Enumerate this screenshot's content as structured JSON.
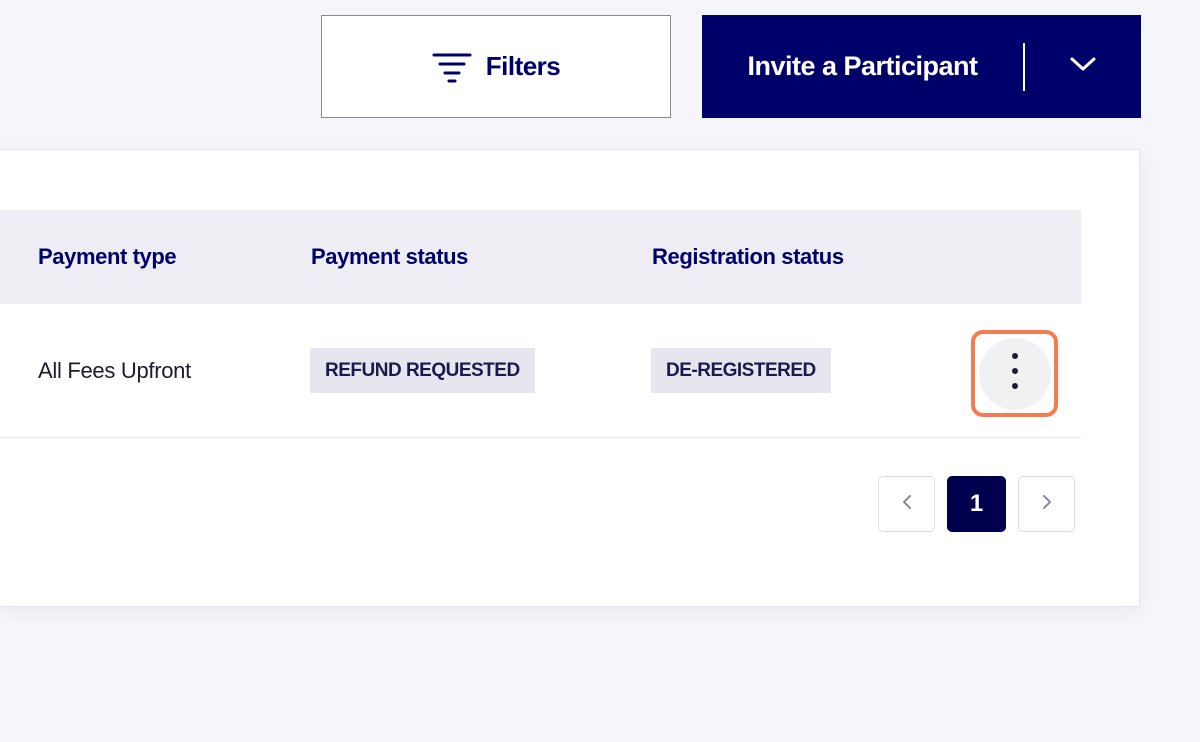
{
  "toolbar": {
    "filters_label": "Filters",
    "invite_label": "Invite a Participant",
    "filters_icon": "filter-lines-icon",
    "invite_caret_icon": "chevron-down-icon"
  },
  "table": {
    "columns": [
      "Payment type",
      "Payment status",
      "Registration status"
    ],
    "rows": [
      {
        "payment_type": "All Fees Upfront",
        "payment_status": "REFUND REQUESTED",
        "registration_status": "DE-REGISTERED",
        "actions_icon": "more-vertical-icon"
      }
    ]
  },
  "pagination": {
    "current_page": "1",
    "prev_icon": "chevron-left-icon",
    "next_icon": "chevron-right-icon"
  },
  "colors": {
    "brand_navy": "#00006b",
    "highlight_orange": "#f47c50",
    "badge_bg": "#e6e6ee",
    "header_bg": "#ededf3"
  }
}
